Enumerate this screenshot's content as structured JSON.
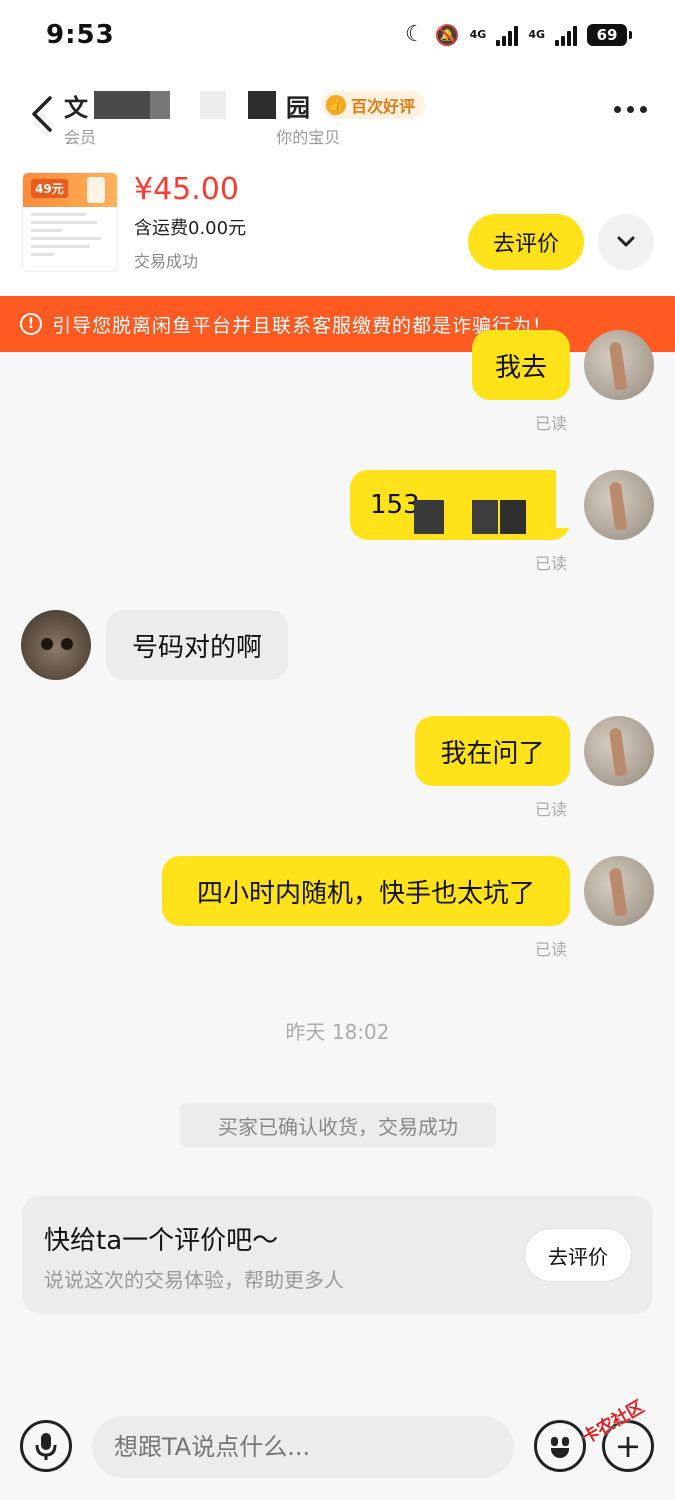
{
  "status_bar": {
    "time": "9:53",
    "network_1": "4G",
    "network_2": "4G",
    "battery": "69"
  },
  "header": {
    "peer_name_start": "文",
    "peer_name_end": "园",
    "badge": "百次好评",
    "subtitle_start": "会员",
    "subtitle_end": "你的宝贝"
  },
  "product": {
    "thumb_price": "49元",
    "price": "¥45.00",
    "shipping": "含运费0.00元",
    "status": "交易成功",
    "review_button": "去评价"
  },
  "warning": {
    "text": "引导您脱离闲鱼平台并且联系客服缴费的都是诈骗行为！"
  },
  "messages": [
    {
      "from": "me",
      "text": "我去",
      "read": "已读"
    },
    {
      "from": "me",
      "text": "153",
      "read": "已读"
    },
    {
      "from": "peer",
      "text": "号码对的啊"
    },
    {
      "from": "me",
      "text": "我在问了",
      "read": "已读"
    },
    {
      "from": "me",
      "text": "四小时内随机，快手也太坑了",
      "read": "已读"
    }
  ],
  "timestamp": "昨天 18:02",
  "system_message": "买家已确认收货，交易成功",
  "review_card": {
    "title": "快给ta一个评价吧～",
    "desc": "说说这次的交易体验，帮助更多人",
    "button": "去评价"
  },
  "input": {
    "placeholder": "想跟TA说点什么..."
  },
  "watermark": "卡农社区",
  "colors": {
    "accent_yellow": "#ffe21a",
    "warning_orange": "#ff5a22",
    "price_red": "#ff3b30"
  },
  "icons": [
    "back-arrow-icon",
    "more-dots-icon",
    "chevron-down-icon",
    "warning-icon",
    "mic-icon",
    "emoji-icon",
    "plus-icon"
  ]
}
